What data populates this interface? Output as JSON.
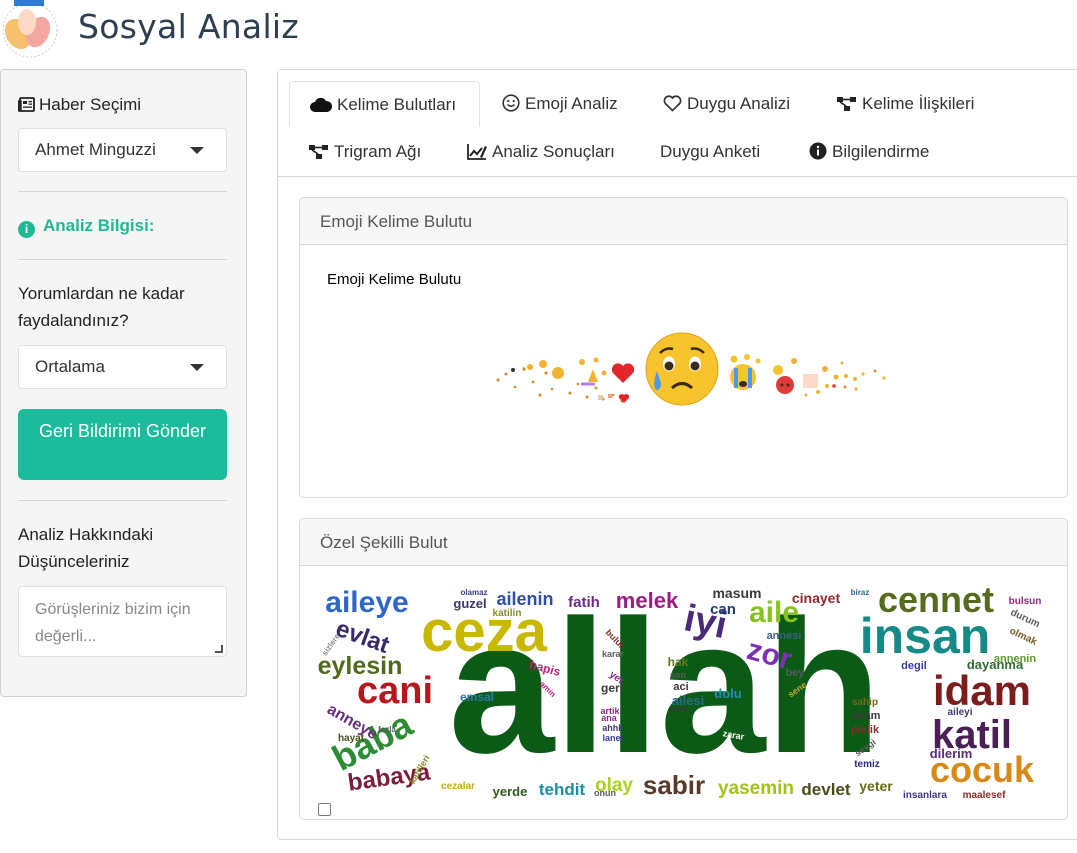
{
  "header": {
    "title": "Sosyal Analiz"
  },
  "sidebar": {
    "news_label": "Haber Seçimi",
    "news_selected": "Ahmet Minguzzi",
    "info_title": "Analiz Bilgisi:",
    "usefulness_question": "Yorumlardan ne kadar faydalandınız?",
    "usefulness_selected": "Ortalama",
    "submit_label": "Geri Bildirimi Gönder",
    "thoughts_label": "Analiz Hakkındaki Düşünceleriniz",
    "thoughts_placeholder": "Görüşleriniz bizim için değerli..."
  },
  "tabs": [
    {
      "label": "Kelime Bulutları",
      "icon": "cloud-icon",
      "active": true
    },
    {
      "label": "Emoji Analiz",
      "icon": "smile-icon"
    },
    {
      "label": "Duygu Analizi",
      "icon": "heart-icon"
    },
    {
      "label": "Kelime İlişkileri",
      "icon": "network-icon"
    },
    {
      "label": "Trigram Ağı",
      "icon": "network-icon"
    },
    {
      "label": "Analiz Sonuçları",
      "icon": "chart-edit-icon"
    },
    {
      "label": "Duygu Anketi",
      "icon": ""
    },
    {
      "label": "Bilgilendirme",
      "icon": "info-icon"
    }
  ],
  "emoji_card": {
    "title": "Emoji Kelime Bulutu",
    "plot_title": "Emoji Kelime Bulutu"
  },
  "shape_card": {
    "title": "Özel Şekilli Bulut"
  },
  "wordcloud": {
    "words": [
      {
        "t": "allah",
        "c": "#0b5a16"
      },
      {
        "t": "ceza",
        "c": "#c9b800"
      },
      {
        "t": "insan",
        "c": "#168a86"
      },
      {
        "t": "cennet",
        "c": "#556b1e"
      },
      {
        "t": "idam",
        "c": "#7b1d1d"
      },
      {
        "t": "katil",
        "c": "#4a1f55"
      },
      {
        "t": "cocuk",
        "c": "#d9891a"
      },
      {
        "t": "cani",
        "c": "#b8161e"
      },
      {
        "t": "baba",
        "c": "#2c8c33"
      },
      {
        "t": "babaya",
        "c": "#7a1f3a"
      },
      {
        "t": "iyi",
        "c": "#4b2a7a"
      },
      {
        "t": "zor",
        "c": "#7d2fb5"
      },
      {
        "t": "aile",
        "c": "#88c21e"
      },
      {
        "t": "aileye",
        "c": "#2f66c9"
      },
      {
        "t": "eylesin",
        "c": "#4d6b1b"
      },
      {
        "t": "evlat",
        "c": "#3a2a6b"
      },
      {
        "t": "melek",
        "c": "#9a1e7f"
      },
      {
        "t": "sabir",
        "c": "#5a3a2a"
      },
      {
        "t": "anneye",
        "c": "#6a2f7a"
      },
      {
        "t": "yasemin",
        "c": "#9fc21e"
      },
      {
        "t": "devlet",
        "c": "#4b4b1b"
      },
      {
        "t": "tehdit",
        "c": "#1b8fa1"
      },
      {
        "t": "olay",
        "c": "#a8d41e"
      },
      {
        "t": "yerde",
        "c": "#2f5a1b"
      },
      {
        "t": "yeter",
        "c": "#6b6b1b"
      },
      {
        "t": "ailenin",
        "c": "#2f4fa8"
      },
      {
        "t": "fatih",
        "c": "#6d2a8a"
      },
      {
        "t": "masum",
        "c": "#3a3a3a"
      },
      {
        "t": "can",
        "c": "#1f3b6b"
      },
      {
        "t": "cinayet",
        "c": "#8a2a2a"
      },
      {
        "t": "annesi",
        "c": "#3a5f8a"
      },
      {
        "t": "dayanma",
        "c": "#2f6b2f"
      },
      {
        "t": "annenin",
        "c": "#5a9a2a"
      },
      {
        "t": "degil",
        "c": "#3a3aa8"
      },
      {
        "t": "dilerim",
        "c": "#5a2a7a"
      },
      {
        "t": "dolu",
        "c": "#2a8ab5"
      },
      {
        "t": "ailesi",
        "c": "#2a6b8a"
      },
      {
        "t": "hak",
        "c": "#5a7a1b"
      },
      {
        "t": "aci",
        "c": "#3a3a3a"
      },
      {
        "t": "emsal",
        "c": "#2a7aa8"
      },
      {
        "t": "hapis",
        "c": "#c21e7a"
      },
      {
        "t": "cezalar",
        "c": "#c2a81e"
      },
      {
        "t": "insanlara",
        "c": "#3a3a8a"
      },
      {
        "t": "maalesef",
        "c": "#8a2a2a"
      },
      {
        "t": "bulsun",
        "c": "#8a2a8a"
      },
      {
        "t": "durum",
        "c": "#5a5a5a"
      },
      {
        "t": "olmak",
        "c": "#7a5a2a"
      },
      {
        "t": "guzel",
        "c": "#3a3a6b"
      },
      {
        "t": "katilin",
        "c": "#8a8a2a"
      },
      {
        "t": "olamaz",
        "c": "#3a3a8a"
      },
      {
        "t": "biraz",
        "c": "#2a6b8a"
      },
      {
        "t": "sahip",
        "c": "#6b6b1b"
      },
      {
        "t": "adam",
        "c": "#3a3a3a"
      },
      {
        "t": "pislik",
        "c": "#8a2a2a"
      },
      {
        "t": "aileyi",
        "c": "#3a3a6b"
      },
      {
        "t": "temiz",
        "c": "#2a2a8a"
      },
      {
        "t": "bey",
        "c": "#5a5a5a"
      },
      {
        "t": "hayat",
        "c": "#4b4b1b"
      },
      {
        "t": "katilleri",
        "c": "#8a8a2a"
      },
      {
        "t": "geri",
        "c": "#3a3a3a"
      },
      {
        "t": "artik",
        "c": "#8a2a8a"
      },
      {
        "t": "yere",
        "c": "#3a3a3a"
      },
      {
        "t": "son",
        "c": "#5a5a5a"
      },
      {
        "t": "lanet",
        "c": "#3a3a8a"
      },
      {
        "t": "ahhh",
        "c": "#3a3a6b"
      },
      {
        "t": "ana",
        "c": "#8a2a8a"
      },
      {
        "t": "karar",
        "c": "#5a5a5a"
      },
      {
        "t": "bulur",
        "c": "#8a2a2a"
      },
      {
        "t": "zarar",
        "c": "#ffffff"
      },
      {
        "t": "agir",
        "c": "#ffffff"
      },
      {
        "t": "sevgi",
        "c": "#5a5a5a"
      },
      {
        "t": "sene",
        "c": "#c2a81e"
      },
      {
        "t": "onun",
        "c": "#5a5a5a"
      },
      {
        "t": "amin",
        "c": "#c21e7a"
      },
      {
        "t": "fazla",
        "c": "#5a5a5a"
      },
      {
        "t": "sizlere",
        "c": "#8a8a8a"
      },
      {
        "t": "yer",
        "c": "#8a2a8a"
      }
    ]
  }
}
